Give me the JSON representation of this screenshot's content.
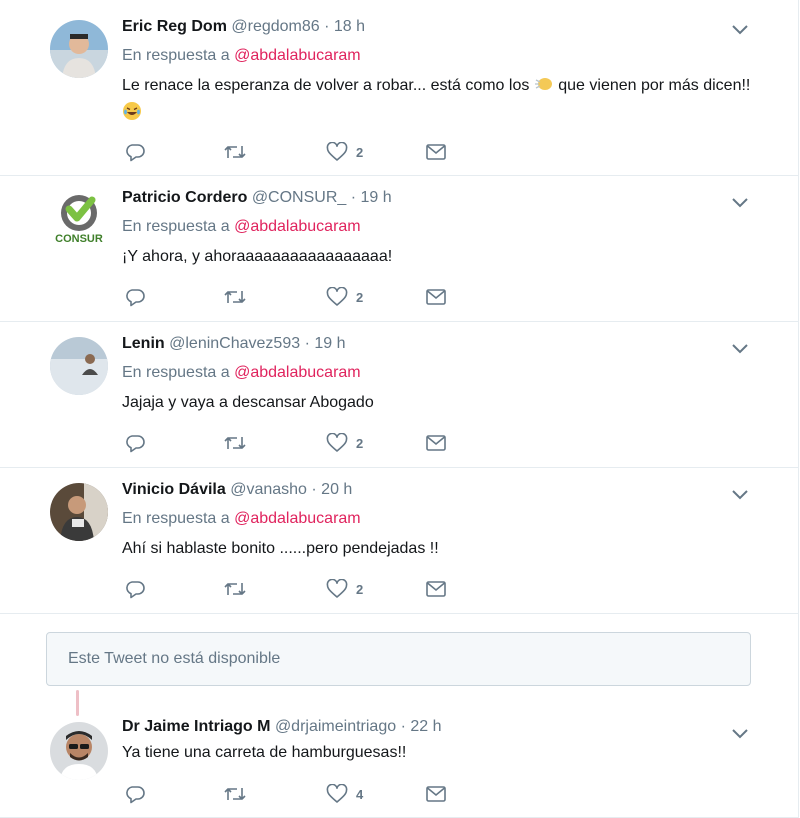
{
  "reply_prefix": "En respuesta a",
  "reply_mention": "@abdalabucaram",
  "icons": {
    "reply": "reply-icon",
    "retweet": "retweet-icon",
    "like": "like-icon",
    "dm": "envelope-icon",
    "menu": "chevron-down-icon"
  },
  "colors": {
    "mention": "#e0245e",
    "muted": "#657786",
    "text": "#14171a",
    "border": "#e6ecf0"
  },
  "tweets": [
    {
      "name": "Eric Reg Dom",
      "handle": "@regdom86",
      "time": "18 h",
      "text_a": "Le renace la esperanza de volver a robar... está como los",
      "text_b": "que vienen por más dicen!!",
      "likes": "2"
    },
    {
      "name": "Patricio Cordero",
      "handle": "@CONSUR_",
      "time": "19 h",
      "text": "¡Y ahora, y ahoraaaaaaaaaaaaaaaaa!",
      "likes": "2",
      "avatar_text": "CONSUR"
    },
    {
      "name": "Lenin",
      "handle": "@leninChavez593",
      "time": "19 h",
      "text": "Jajaja y vaya a descansar Abogado",
      "likes": "2"
    },
    {
      "name": "Vinicio Dávila",
      "handle": "@vanasho",
      "time": "20 h",
      "text": "Ahí si hablaste bonito ......pero pendejadas !!",
      "likes": "2"
    }
  ],
  "unavailable": "Este Tweet no está disponible",
  "last_tweet": {
    "name": "Dr Jaime Intriago M",
    "handle": "@drjaimeintriago",
    "time": "22 h",
    "text": "Ya tiene una carreta de hamburguesas!!",
    "likes": "4"
  }
}
